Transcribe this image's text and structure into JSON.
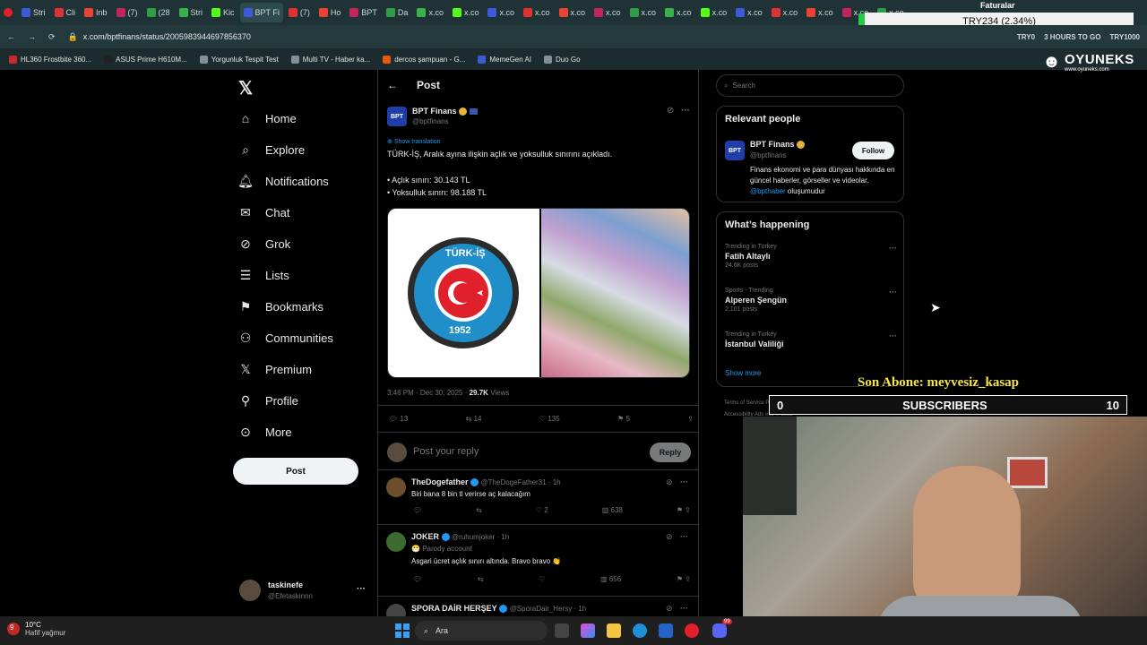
{
  "browser": {
    "tabs": [
      "Stri",
      "Cli",
      "Inb",
      "(7)",
      "(28",
      "Stri",
      "Kic",
      "BPT Fi",
      "(7)",
      "Ho",
      "BPT",
      "Da",
      "x.co",
      "x.co",
      "x.co",
      "x.co",
      "x.co",
      "x.co",
      "x.co",
      "x.co",
      "x.co",
      "x.co",
      "x.co",
      "x.co",
      "x.co",
      "x.co"
    ],
    "url": "x.com/bptfinans/status/2005983944697856370",
    "bookmarks": [
      "HL360 Frostbite 360...",
      "ASUS Prime H610M...",
      "Yorgunluk Tespit Test",
      "Multi TV - Haber ka...",
      "dercos şampuan - G...",
      "MemeGen AI",
      "Duo Go"
    ],
    "ext_labels": [
      "TRY0",
      "3 HOURS TO GO",
      "TRY1000"
    ]
  },
  "overlay": {
    "faturalar": "Faturalar",
    "ticker": "TRY234 (2.34%)",
    "logo": "OYUNEKS",
    "logo_sub": "www.oyuneks.com",
    "son_abone": "Son Abone: meyvesiz_kasap",
    "subs_label": "SUBSCRIBERS",
    "subs_current": "0",
    "subs_goal": "10"
  },
  "nav": {
    "items": [
      "Home",
      "Explore",
      "Notifications",
      "Chat",
      "Grok",
      "Lists",
      "Bookmarks",
      "Communities",
      "Premium",
      "Profile",
      "More"
    ],
    "post_button": "Post",
    "account_name": "taskinefe",
    "account_handle": "@Efetaskinnn",
    "more_glyph": "···"
  },
  "post": {
    "header_title": "Post",
    "author_name": "BPT Finans",
    "author_handle": "@bptfinans",
    "show_translation": "Show translation",
    "text_line1": "TÜRK-İŞ, Aralık ayına ilişkin açlık ve yoksulluk sınırını açıkladı.",
    "text_line2": "• Açlık sınırı: 30.143 TL",
    "text_line3": "• Yoksulluk sınırı: 98.188 TL",
    "image_left_ring": "TÜRK-İŞ",
    "image_left_year": "1952",
    "timestamp": "3:46 PM · Dec 30, 2025 · ",
    "views_count": "29.7K",
    "views_label": " Views",
    "replies": "13",
    "reposts": "14",
    "likes": "135",
    "bookmarks": "5",
    "reply_placeholder": "Post your reply",
    "reply_button": "Reply"
  },
  "replies": [
    {
      "name": "TheDogefather",
      "handle": "@TheDogeFather31 · 1h",
      "badge": "",
      "text": "Biri bana 8 bin tl verirse aç kalacağım",
      "reposts": "",
      "likes": "2",
      "views": "638"
    },
    {
      "name": "JOKER",
      "handle": "@ruhumjoker · 1h",
      "badge": "Parody account",
      "text": "Asgari ücret açlık sınırı altında. Bravo bravo 👏",
      "reposts": "",
      "likes": "",
      "views": "656"
    },
    {
      "name": "SPORA DAİR HERŞEY",
      "handle": "@SporaDair_Hersy · 1h",
      "badge": "",
      "text": "",
      "reposts": "",
      "likes": "",
      "views": ""
    }
  ],
  "sidebar": {
    "search_placeholder": "Search",
    "relevant_title": "Relevant people",
    "rp_name": "BPT Finans",
    "rp_handle": "@bptfinans",
    "follow": "Follow",
    "rp_bio": "Finans ekonomi ve para dünyası hakkında en güncel haberler, görseller ve videolar.",
    "rp_bio_mention": "@bpthaber",
    "rp_bio_end": " oluşumudur",
    "happening_title": "What’s happening",
    "trends": [
      {
        "context": "Trending in Turkey",
        "title": "Fatih Altaylı",
        "count": "24.6K posts"
      },
      {
        "context": "Sports · Trending",
        "title": "Alperen Şengün",
        "count": "2,101 posts"
      },
      {
        "context": "Trending in Turkey",
        "title": "İstanbul Valiliği",
        "count": ""
      }
    ],
    "show_more": "Show more",
    "footer": "Terms of Service  Privacy Policy  Cookie Policy  Imprint  Accessibility  Ads info  © 2025"
  },
  "taskbar": {
    "weather_temp": "10°C",
    "weather_desc": "Hafif yağmur",
    "weather_badge": "9",
    "search_label": "Ara",
    "notif_badge": "99"
  },
  "colors": {
    "accent": "#1d9bf0",
    "background": "#000000",
    "border": "#2f3336",
    "muted": "#71767b",
    "overlay_yellow": "#f5e64a"
  }
}
